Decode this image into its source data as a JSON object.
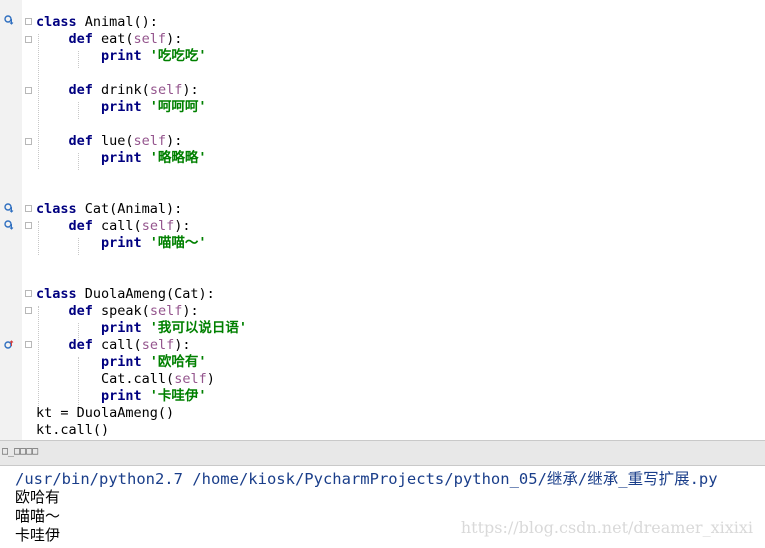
{
  "editor": {
    "lines": [
      {
        "id": "l0",
        "text": "\"\"\""
      },
      {
        "id": "l1",
        "kw": "class",
        "rest": " Animal():"
      },
      {
        "id": "l2",
        "indent": "    ",
        "kw": "def",
        "name": " eat(",
        "self": "self",
        "end": "):"
      },
      {
        "id": "l3",
        "indent": "        ",
        "kw": "print",
        "str": " '吃吃吃'"
      },
      {
        "id": "l5",
        "indent": "    ",
        "kw": "def",
        "name": " drink(",
        "self": "self",
        "end": "):"
      },
      {
        "id": "l6",
        "indent": "        ",
        "kw": "print",
        "str": " '呵呵呵'"
      },
      {
        "id": "l8",
        "indent": "    ",
        "kw": "def",
        "name": " lue(",
        "self": "self",
        "end": "):"
      },
      {
        "id": "l9",
        "indent": "        ",
        "kw": "print",
        "str": " '略略略'"
      },
      {
        "id": "l12",
        "kw": "class",
        "rest": " Cat(Animal):"
      },
      {
        "id": "l13",
        "indent": "    ",
        "kw": "def",
        "name": " call(",
        "self": "self",
        "end": "):"
      },
      {
        "id": "l14",
        "indent": "        ",
        "kw": "print",
        "str": " '喵喵～'"
      },
      {
        "id": "l17",
        "kw": "class",
        "rest": " DuolaAmeng(Cat):"
      },
      {
        "id": "l18",
        "indent": "    ",
        "kw": "def",
        "name": " speak(",
        "self": "self",
        "end": "):"
      },
      {
        "id": "l19",
        "indent": "        ",
        "kw": "print",
        "str": " '我可以说日语'"
      },
      {
        "id": "l20",
        "indent": "    ",
        "kw": "def",
        "name": " call(",
        "self": "self",
        "end": "):"
      },
      {
        "id": "l21",
        "indent": "        ",
        "kw": "print",
        "str": " '欧哈有'"
      },
      {
        "id": "l22",
        "indent": "        ",
        "name": "Cat.call(",
        "self": "self",
        "end": ")"
      },
      {
        "id": "l23",
        "indent": "        ",
        "kw": "print",
        "str": " '卡哇伊'"
      },
      {
        "id": "l24",
        "rest": "kt = DuolaAmeng()"
      },
      {
        "id": "l25",
        "rest": "kt.call()"
      }
    ]
  },
  "panel": {
    "title": "□_□□□□"
  },
  "console": {
    "command": "/usr/bin/python2.7 /home/kiosk/PycharmProjects/python_05/继承/继承_重写扩展.py",
    "output": [
      "欧哈有",
      "喵喵～",
      "卡哇伊"
    ]
  },
  "watermark": "https://blog.csdn.net/dreamer_xixixi",
  "colors": {
    "keyword": "#000080",
    "self": "#94558d",
    "string": "#008000",
    "override_marker": "#d04040",
    "implemented_marker": "#2f6fc0"
  }
}
